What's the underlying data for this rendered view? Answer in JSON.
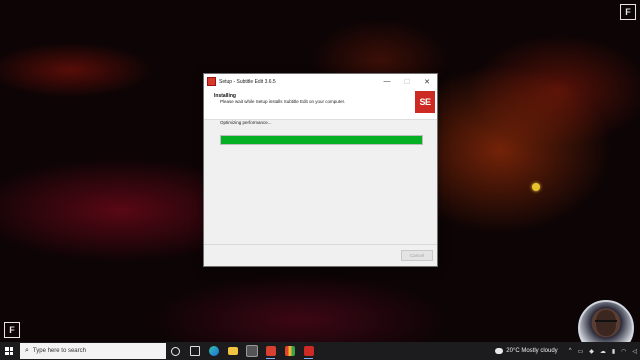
{
  "desktop": {
    "corner_logo_text": "F"
  },
  "dialog": {
    "title": "Setup - Subtitle Edit 3.6.5",
    "window_buttons": {
      "minimize": "—",
      "maximize": "☐",
      "close": "✕"
    },
    "header_title": "Installing",
    "header_subtitle": "Please wait while Setup installs Subtitle Edit on your computer.",
    "logo_text": "SE",
    "status_text": "Optimizing performance...",
    "progress": 1.0,
    "cancel_label": "Cancel"
  },
  "taskbar": {
    "search_placeholder": "Type here to search",
    "weather": "20°C  Mostly cloudy",
    "pinned_icons": [
      "task-view-icon",
      "widgets-icon",
      "edge-icon",
      "file-explorer-icon",
      "media-icon",
      "app-red-icon",
      "app-multicolor-icon",
      "subtitle-edit-icon"
    ],
    "tray_icons": [
      "chevron-up-icon",
      "network-icon",
      "dropbox-icon",
      "onedrive-icon",
      "battery-icon",
      "wifi-icon",
      "volume-icon"
    ]
  },
  "colors": {
    "progress_green": "#06b025",
    "se_red": "#cc2a22",
    "taskbar": "#1c1c1e"
  }
}
